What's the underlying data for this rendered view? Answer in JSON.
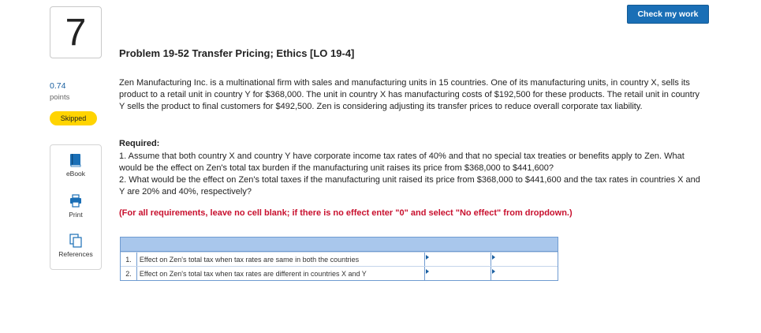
{
  "header": {
    "check_button": "Check my work"
  },
  "question": {
    "number": "7",
    "points_value": "0.74",
    "points_label": "points",
    "status": "Skipped"
  },
  "tools": [
    {
      "label": "eBook",
      "icon": "book-icon"
    },
    {
      "label": "Print",
      "icon": "printer-icon"
    },
    {
      "label": "References",
      "icon": "references-icon"
    }
  ],
  "problem": {
    "title": "Problem 19-52 Transfer Pricing; Ethics [LO 19-4]",
    "intro": "Zen Manufacturing Inc. is a multinational firm with sales and manufacturing units in 15 countries. One of its manufacturing units, in country X, sells its product to a retail unit in country Y for $368,000. The unit in country X has manufacturing costs of $192,500 for these products. The retail unit in country Y sells the product to final customers for $492,500. Zen is considering adjusting its transfer prices to reduce overall corporate tax liability.",
    "required_heading": "Required:",
    "required_1": "1. Assume that both country X and country Y have corporate income tax rates of 40% and that no special tax treaties or benefits apply to Zen. What would be the effect on Zen's total tax burden if the manufacturing unit raises its price from $368,000 to $441,600?",
    "required_2": "2. What would be the effect on Zen's total taxes if the manufacturing unit raised its price from $368,000 to $441,600 and the tax rates in countries X and Y are 20% and 40%, respectively?",
    "note": "(For all requirements, leave no cell blank; if there is no effect enter \"0\" and select \"No effect\" from dropdown.)"
  },
  "table": {
    "rows": [
      {
        "num": "1.",
        "desc": "Effect on Zen's total tax when tax rates are same in both the countries",
        "amount": "",
        "effect": ""
      },
      {
        "num": "2.",
        "desc": "Effect on Zen's total tax when tax rates are different in countries X and Y",
        "amount": "",
        "effect": ""
      }
    ]
  },
  "colors": {
    "accent": "#1a6fb6",
    "note_red": "#c8102e",
    "badge_yellow": "#ffd400",
    "table_header": "#a9c7ec"
  }
}
